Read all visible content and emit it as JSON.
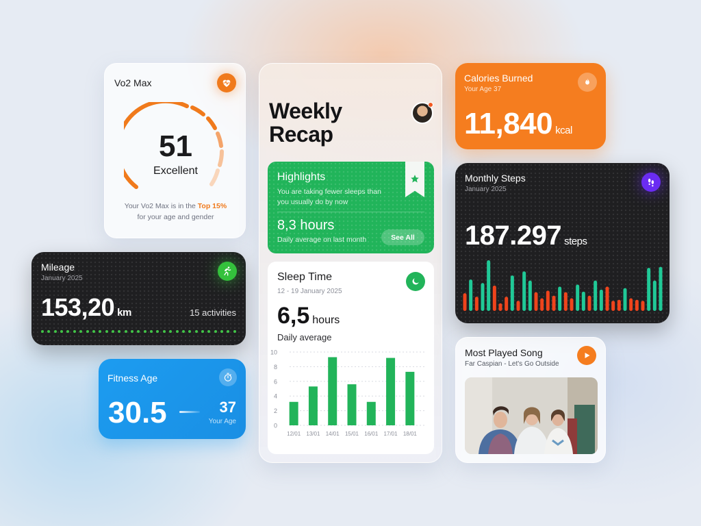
{
  "vo2": {
    "title": "Vo2 Max",
    "value": "51",
    "rating": "Excellent",
    "note_prefix": "Your Vo2 Max is in the",
    "note_highlight": "Top 15%",
    "note_suffix": "for your age and gender",
    "icon": "heart-pulse-icon",
    "accent": "#f07a1c"
  },
  "mileage": {
    "title": "Mileage",
    "period": "January 2025",
    "value": "153,20",
    "unit": "km",
    "activities": "15 activities",
    "icon": "running-icon",
    "accent": "#34c13c"
  },
  "fitness_age": {
    "title": "Fitness Age",
    "value": "30.5",
    "your_age": "37",
    "your_age_label": "Your Age",
    "icon": "stopwatch-icon",
    "accent": "#1c9cf0"
  },
  "weekly": {
    "heading_line1": "Weekly",
    "heading_line2": "Recap",
    "avatar": "user-avatar"
  },
  "highlights": {
    "title": "Highlights",
    "description": "You are taking fewer sleeps than you usually do by now",
    "value": "8,3 hours",
    "value_label": "Daily average on last month",
    "button": "See All",
    "icon": "star-icon",
    "accent": "#21b45a"
  },
  "sleep": {
    "title": "Sleep Time",
    "range": "12 - 19 January 2025",
    "value": "6,5",
    "unit": "hours",
    "label": "Daily average",
    "icon": "moon-icon"
  },
  "calories": {
    "title": "Calories Burned",
    "subtitle": "Your Age 37",
    "value": "11,840",
    "unit": "kcal",
    "icon": "flame-icon",
    "accent": "#f57d1f"
  },
  "steps": {
    "title": "Monthly Steps",
    "period": "January 2025",
    "value": "187.297",
    "unit": "steps",
    "icon": "footprints-icon",
    "accent": "#6a2cf2",
    "colors": {
      "high": "#20c997",
      "low": "#f0441c"
    }
  },
  "song": {
    "title": "Most Played Song",
    "artist_track": "Far Caspian - Let's Go Outside",
    "icon": "play-icon"
  },
  "chart_data": [
    {
      "type": "bar",
      "categories": [
        "12/01",
        "13/01",
        "14/01",
        "15/01",
        "16/01",
        "17/01",
        "18/01"
      ],
      "values": [
        3.2,
        5.3,
        9.3,
        5.6,
        3.2,
        9.2,
        7.3
      ],
      "ylim": [
        0,
        10
      ],
      "yticks": [
        0,
        2,
        4,
        6,
        8,
        10
      ],
      "grid": true,
      "color": "#22b45a"
    },
    {
      "type": "bar",
      "values": [
        35,
        62,
        28,
        55,
        100,
        50,
        15,
        28,
        70,
        20,
        78,
        60,
        37,
        25,
        40,
        30,
        48,
        37,
        25,
        52,
        38,
        30,
        60,
        42,
        48,
        20,
        22,
        45,
        25,
        22,
        20,
        85,
        60,
        87
      ],
      "series_colors": [
        "low",
        "high",
        "low",
        "high",
        "high",
        "low",
        "low",
        "low",
        "high",
        "low",
        "high",
        "high",
        "low",
        "low",
        "low",
        "low",
        "high",
        "low",
        "low",
        "high",
        "high",
        "low",
        "high",
        "high",
        "low",
        "low",
        "low",
        "high",
        "low",
        "low",
        "low",
        "high",
        "high",
        "high"
      ]
    }
  ]
}
